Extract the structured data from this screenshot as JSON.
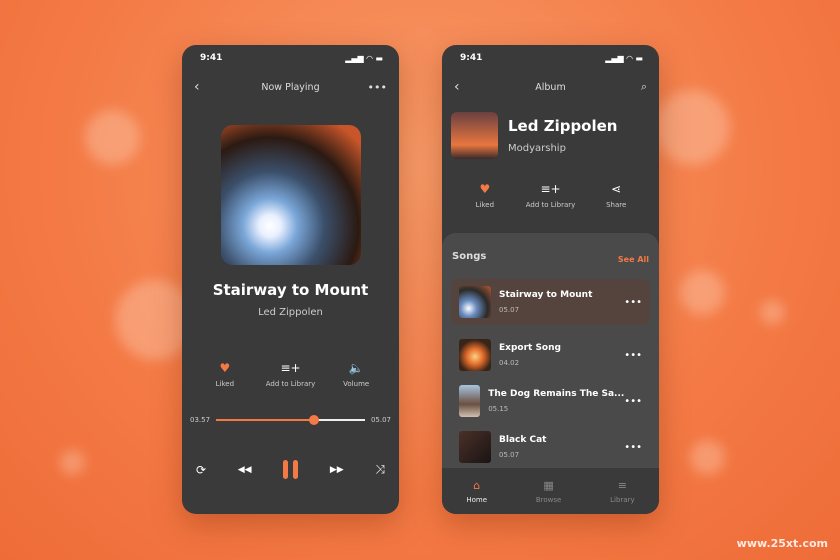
{
  "player": {
    "time": "9:41",
    "title": "Now Playing",
    "song": "Stairway to Mount",
    "artist": "Led Zippolen",
    "actions": [
      {
        "icon": "heart-icon",
        "label": "Liked"
      },
      {
        "icon": "add-playlist-icon",
        "label": "Add to Library"
      },
      {
        "icon": "volume-icon",
        "label": "Volume"
      }
    ],
    "elapsed": "03.57",
    "duration": "05.07",
    "progress_percent": 66
  },
  "album": {
    "time": "9:41",
    "title": "Album",
    "name": "Led Zippolen",
    "artist": "Modyarship",
    "actions": [
      {
        "icon": "heart-icon",
        "label": "Liked"
      },
      {
        "icon": "add-playlist-icon",
        "label": "Add to Library"
      },
      {
        "icon": "share-icon",
        "label": "Share"
      }
    ],
    "songs_heading": "Songs",
    "see_all": "See All",
    "songs": [
      {
        "name": "Stairway to Mount",
        "duration": "05.07",
        "active": true
      },
      {
        "name": "Export Song",
        "duration": "04.02"
      },
      {
        "name": "The Dog Remains The Sa...",
        "duration": "05.15"
      },
      {
        "name": "Black Cat",
        "duration": "05.07"
      }
    ],
    "nav": [
      {
        "icon": "home-icon",
        "label": "Home",
        "active": true
      },
      {
        "icon": "grid-icon",
        "label": "Browse"
      },
      {
        "icon": "library-icon",
        "label": "Library"
      }
    ]
  },
  "colors": {
    "accent": "#f47a45",
    "surface": "#3a3a3a"
  },
  "watermark": "www.25xt.com"
}
